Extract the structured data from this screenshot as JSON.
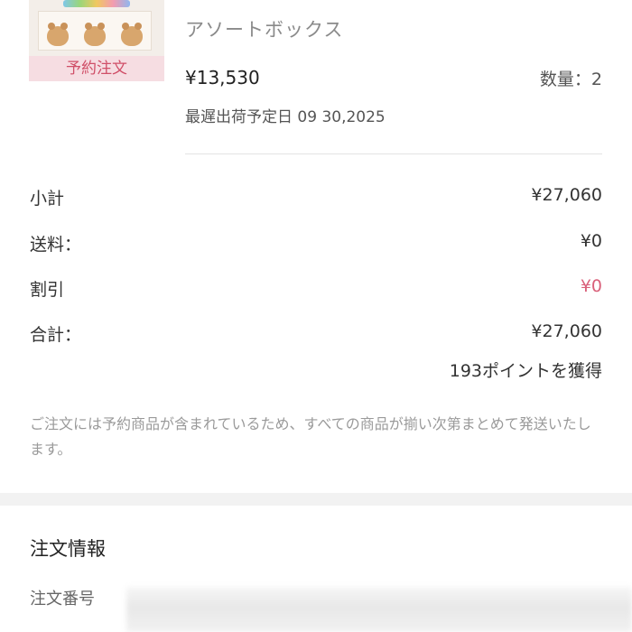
{
  "product": {
    "badge": "予約注文",
    "name": "アソートボックス",
    "price": "¥13,530",
    "quantity": "数量：2",
    "latest_ship_date": "最遅出荷予定日 09 30,2025"
  },
  "summary": {
    "subtotal_label": "小計",
    "subtotal_value": "¥27,060",
    "shipping_label": "送料：",
    "shipping_value": "¥0",
    "discount_label": "割引",
    "discount_value": "¥0",
    "total_label": "合計：",
    "total_value": "¥27,060",
    "points": "193ポイントを獲得",
    "notice": "ご注文には予約商品が含まれているため、すべての商品が揃い次第まとめて発送いたします。"
  },
  "order_info": {
    "title": "注文情報",
    "order_number_label": "注文番号"
  },
  "colors": {
    "discount": "#d9607a",
    "badge_text": "#d04f68",
    "badge_bg": "#f6dde2"
  }
}
